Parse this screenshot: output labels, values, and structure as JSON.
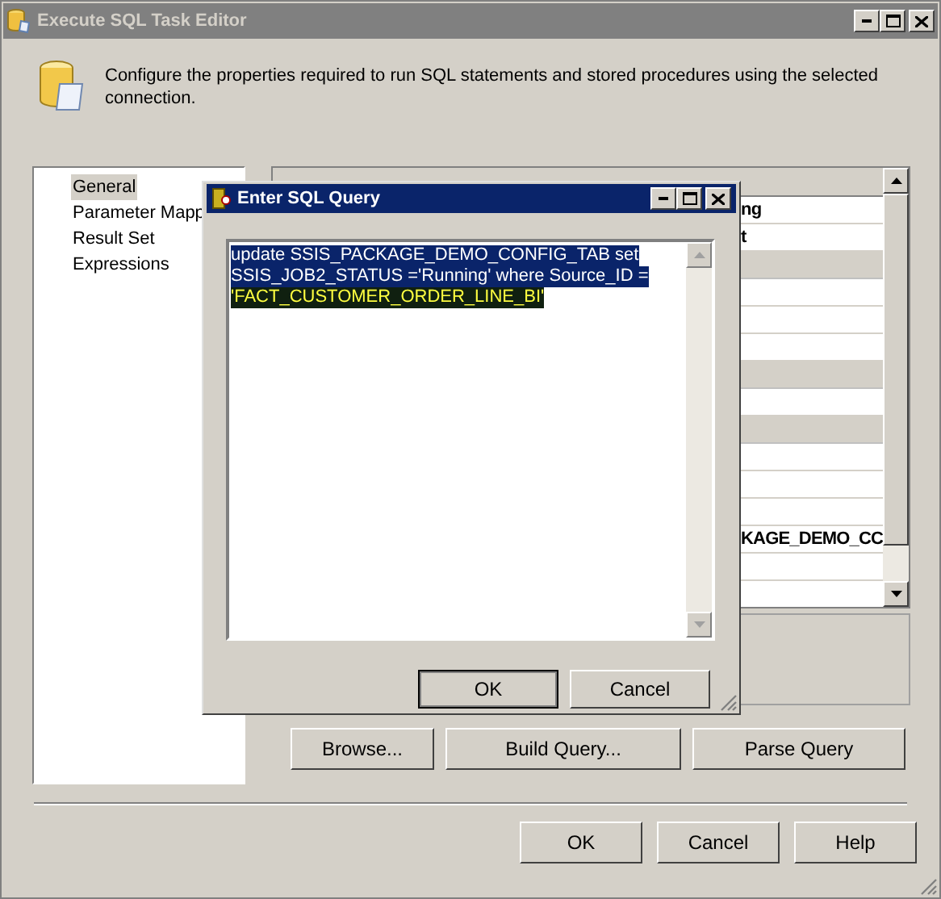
{
  "window": {
    "title": "Execute SQL Task Editor",
    "active": false
  },
  "description": "Configure the properties required to run SQL statements and stored procedures using the selected connection.",
  "sidebar": {
    "items": [
      {
        "label": "General",
        "selected": true
      },
      {
        "label": "Parameter Mapp",
        "selected": false
      },
      {
        "label": "Result Set",
        "selected": false
      },
      {
        "label": "Expressions",
        "selected": false
      }
    ]
  },
  "property_grid": {
    "rows": [
      {
        "kind": "header"
      },
      {
        "kind": "property",
        "text": "ng"
      },
      {
        "kind": "property",
        "text": "t"
      },
      {
        "kind": "category"
      },
      {
        "kind": "property"
      },
      {
        "kind": "property"
      },
      {
        "kind": "property"
      },
      {
        "kind": "category"
      },
      {
        "kind": "property"
      },
      {
        "kind": "category"
      },
      {
        "kind": "property"
      },
      {
        "kind": "property"
      },
      {
        "kind": "property"
      },
      {
        "kind": "property",
        "text": "KAGE_DEMO_CC"
      },
      {
        "kind": "property"
      },
      {
        "kind": "property"
      }
    ]
  },
  "query_buttons": [
    "Browse...",
    "Build Query...",
    "Parse Query"
  ],
  "buttons": [
    "OK",
    "Cancel",
    "Help"
  ],
  "dialog": {
    "title": "Enter SQL Query",
    "active": true,
    "query_lines": [
      {
        "text": "update SSIS_PACKAGE_DEMO_CONFIG_TAB set",
        "kind": "selection"
      },
      {
        "text": "SSIS_JOB2_STATUS ='Running' where Source_ID =",
        "kind": "selection"
      },
      {
        "text": "'FACT_CUSTOMER_ORDER_LINE_BI'",
        "kind": "match"
      }
    ],
    "buttons": [
      {
        "label": "OK",
        "default": true
      },
      {
        "label": "Cancel",
        "default": false
      }
    ]
  }
}
